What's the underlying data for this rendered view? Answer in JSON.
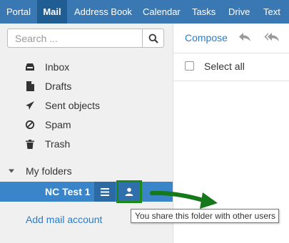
{
  "nav": {
    "tabs": [
      {
        "label": "Portal"
      },
      {
        "label": "Mail",
        "active": true
      },
      {
        "label": "Address Book"
      },
      {
        "label": "Calendar"
      },
      {
        "label": "Tasks"
      },
      {
        "label": "Drive"
      },
      {
        "label": "Text"
      }
    ]
  },
  "search": {
    "placeholder": "Search ...",
    "icon": "search-icon"
  },
  "folders": [
    {
      "label": "Inbox",
      "icon": "inbox-icon"
    },
    {
      "label": "Drafts",
      "icon": "document-icon"
    },
    {
      "label": "Sent objects",
      "icon": "paper-plane-icon"
    },
    {
      "label": "Spam",
      "icon": "ban-icon"
    },
    {
      "label": "Trash",
      "icon": "trash-icon"
    }
  ],
  "my_folders": {
    "label": "My folders",
    "icon": "caret-down-icon"
  },
  "shared_folder": {
    "label": "NC Test 1",
    "menu_icon": "menu-icon",
    "share_icon": "user-icon"
  },
  "add_account": "Add mail account",
  "toolbar": {
    "compose": "Compose",
    "reply_icon": "reply-icon",
    "reply_all_icon": "reply-all-icon"
  },
  "list": {
    "select_all": "Select all"
  },
  "tooltip": "You share this folder with other users",
  "colors": {
    "nav_bg": "#3a78b3",
    "nav_active": "#1f5d93",
    "selected_row": "#3a84c9",
    "link": "#2a7cc7",
    "highlight": "#1b8a1b"
  }
}
